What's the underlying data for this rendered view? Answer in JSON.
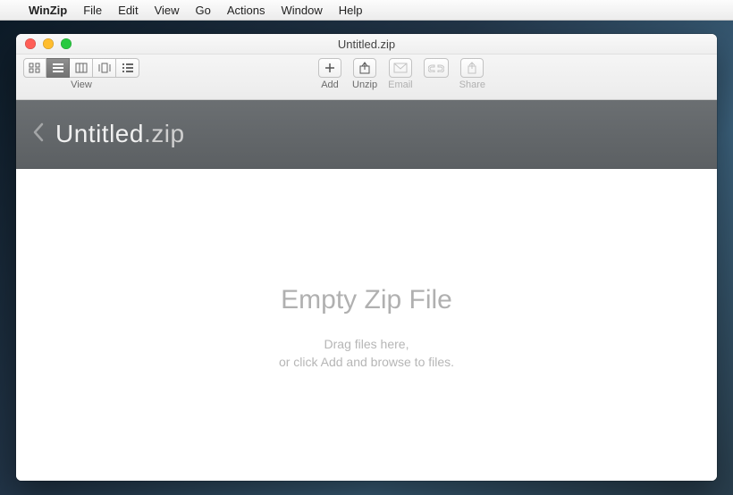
{
  "menubar": {
    "appname": "WinZip",
    "items": [
      "File",
      "Edit",
      "View",
      "Go",
      "Actions",
      "Window",
      "Help"
    ]
  },
  "window": {
    "title": "Untitled.zip"
  },
  "toolbar": {
    "view_label": "View",
    "add_label": "Add",
    "unzip_label": "Unzip",
    "email_label": "Email",
    "share_label": "Share"
  },
  "banner": {
    "name": "Untitled",
    "ext": ".zip"
  },
  "empty": {
    "title": "Empty Zip File",
    "line1": "Drag files here,",
    "line2": "or click Add and browse to files."
  }
}
